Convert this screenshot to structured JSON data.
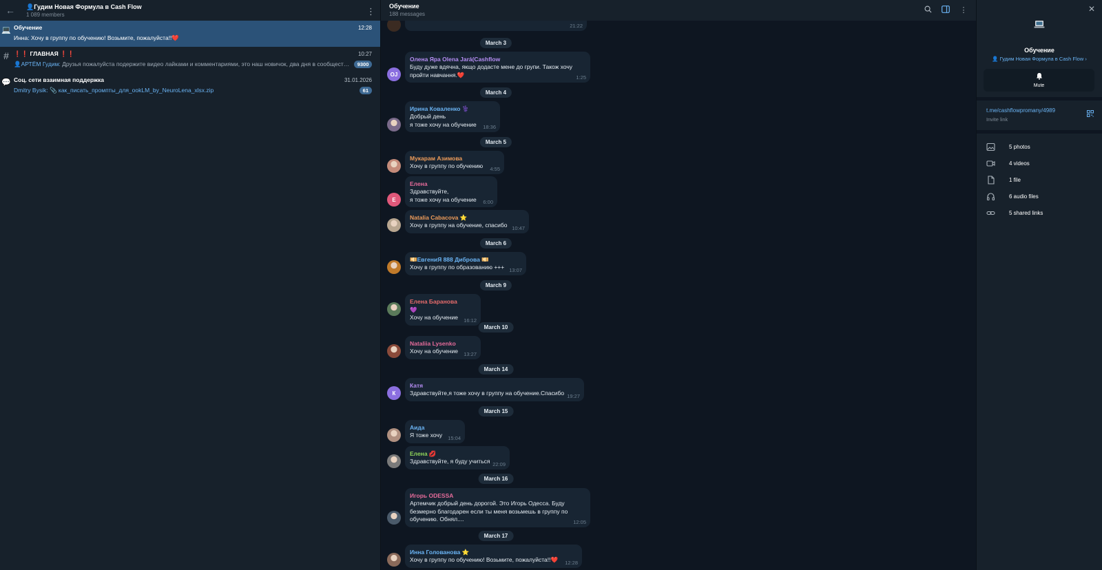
{
  "left": {
    "title": "Гудим Новая Формула в Cash Flow",
    "members": "1 089 members",
    "chats": [
      {
        "name": "Обучение",
        "time": "12:28",
        "sender": "Инна:",
        "preview": "Хочу в группу по обучению! Возьмите, пожалуйста!!❤️",
        "badge": ""
      },
      {
        "name": "ГЛАВНАЯ",
        "time": "10:27",
        "sender": "АРТЁМ Гудим:",
        "preview": "Друзья пожалуйста подержите видео лайками и комментариями, это наш новичок, два дня в сообществе н...",
        "badge": "9300",
        "mark": "❗❗",
        "mark2": "❗❗"
      },
      {
        "name": "Соц. сети взаимная поддержка",
        "time": "31.01.2026",
        "sender": "Dmitry Bysik:",
        "preview": "📎 как_писать_промпты_для_ookLM_by_NeuroLena_xlsx.zip",
        "badge": "61"
      }
    ]
  },
  "middle": {
    "title": "Обучение",
    "subtitle": "188 messages",
    "top_partial_time": "21:22",
    "dates": [
      "March 3",
      "March 4",
      "March 5",
      "March 6",
      "March 9",
      "March 10",
      "March 14",
      "March 15",
      "March 16",
      "March 17"
    ],
    "messages": [
      {
        "sender": "Олена Яра Olena Jará(Cashflow",
        "text": "Буду дуже вдячна, якщо додасте мене до групи. Також хочу пройти навчання.❤️",
        "time": "1:25",
        "avatar": "OJ",
        "color": "#b48cf2"
      },
      {
        "sender": "Ирина Коваленко ⚕️",
        "text": "Добрый день\nя  тоже хочу на обучение",
        "time": "18:36",
        "color": "#6ab3f3"
      },
      {
        "sender": "Мукарам Азимова",
        "text": "Хочу в группу по обучению",
        "time": "4:55",
        "color": "#ee9c5a"
      },
      {
        "sender": "Елена",
        "text": "Здравствуйте,\nя  тоже хочу на обучение",
        "time": "6:00",
        "avatar": "E",
        "color": "#e56b9a"
      },
      {
        "sender": "Natalia Cabacova ⭐",
        "text": "Хочу в группу на обучение, спасибо",
        "time": "10:47",
        "color": "#ee9c5a"
      },
      {
        "sender": "💴ЕвгениЯ 888 Диброва 💴",
        "text": "Хочу в группу по образованию +++",
        "time": "13:07",
        "color": "#6ab3f3"
      },
      {
        "sender": "Елена Баранова 💜",
        "text": "Хочу на обучение",
        "time": "16:12",
        "color": "#e56b6b"
      },
      {
        "sender": "Nataliia Lysenko",
        "text": "Хочу на обучение",
        "time": "13:27",
        "color": "#e56b9a"
      },
      {
        "sender": "Катя",
        "text": "Здравствуйте,я тоже хочу в группу на обучение.Спасибо",
        "time": "19:27",
        "avatar": "К",
        "color": "#b48cf2"
      },
      {
        "sender": "Аида",
        "text": "Я тоже хочу",
        "time": "15:04",
        "color": "#6ab3f3"
      },
      {
        "sender": "Елена 💋",
        "text": "Здравствуйте, я буду учиться",
        "time": "22:09",
        "color": "#8ed35a"
      },
      {
        "sender": "Игорь ODESSA",
        "text": "Артемчик добрый день дорогой. Это Игорь Одесса. Буду безмерно благодарен если ты меня возьмешь в группу по обучению. Обнял....",
        "time": "12:05",
        "color": "#e56b9a"
      },
      {
        "sender": "Инна Голованова ⭐",
        "text": "Хочу в группу по обучению! Возьмите, пожалуйста!!❤️",
        "time": "12:28",
        "color": "#6ab3f3"
      }
    ]
  },
  "right": {
    "title": "Обучение",
    "parent_link": "Гудим Новая Формула в Cash Flow ›",
    "mute_label": "Mute",
    "invite_url": "t.me/cashflowpromany/4989",
    "invite_label": "Invite link",
    "media": [
      {
        "icon": "photo-icon",
        "label": "5 photos"
      },
      {
        "icon": "video-icon",
        "label": "4 videos"
      },
      {
        "icon": "file-icon",
        "label": "1 file"
      },
      {
        "icon": "headphones-icon",
        "label": "6 audio files"
      },
      {
        "icon": "link-icon",
        "label": "5 shared links"
      }
    ]
  },
  "colors": {
    "bg": "#0e1621",
    "panel": "#17212b",
    "accent": "#2b5278",
    "bubble": "#182533",
    "link": "#6ab3f3"
  }
}
